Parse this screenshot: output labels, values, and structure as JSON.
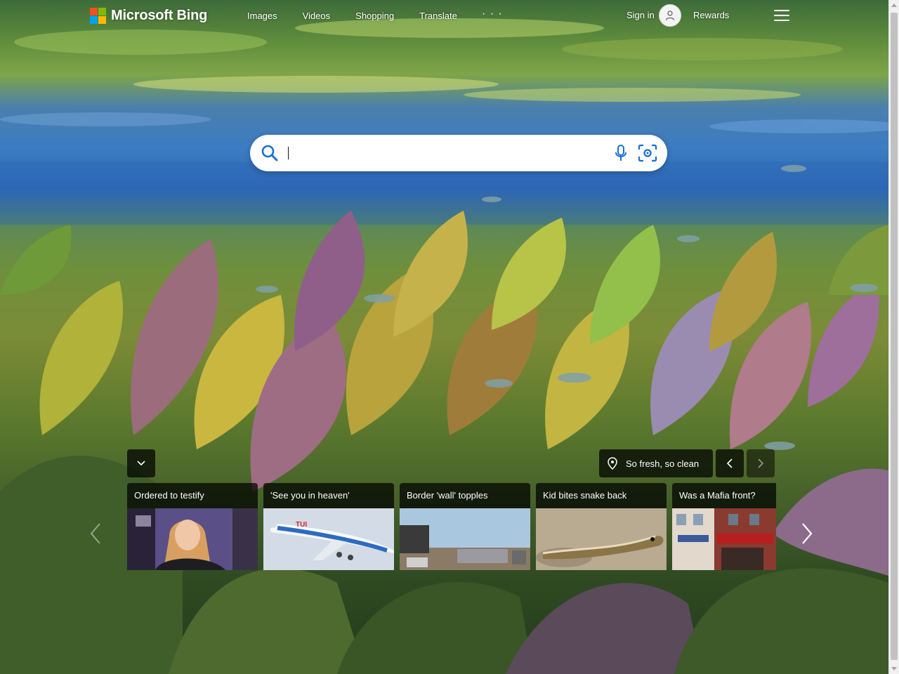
{
  "brand": {
    "name": "Microsoft Bing",
    "logo_colors": [
      "#f25022",
      "#7fba00",
      "#00a4ef",
      "#ffb900"
    ]
  },
  "nav": {
    "items": [
      "Images",
      "Videos",
      "Shopping",
      "Translate"
    ],
    "more": "· · ·"
  },
  "account": {
    "signin_label": "Sign in",
    "rewards_label": "Rewards"
  },
  "search": {
    "value": "",
    "placeholder": ""
  },
  "image_of_day": {
    "location_label": "So fresh, so clean"
  },
  "news": {
    "cards": [
      {
        "title": "Ordered to testify"
      },
      {
        "title": "'See you in heaven'"
      },
      {
        "title": "Border 'wall' topples"
      },
      {
        "title": "Kid bites snake back"
      },
      {
        "title": "Was a Mafia front?"
      }
    ]
  },
  "colors": {
    "search_icon": "#1a6fd6",
    "overlay": "rgba(0,0,0,0.72)"
  }
}
